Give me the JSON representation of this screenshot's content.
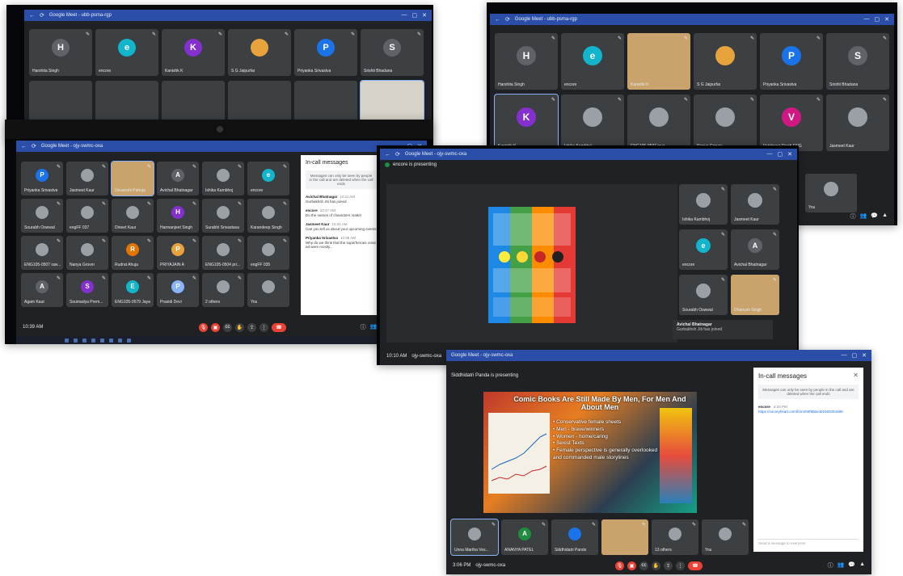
{
  "app": "Google Meet",
  "colors": {
    "meet_bg": "#202124",
    "tile_bg": "#3c4043",
    "chrome_bar": "#2b4fa8",
    "end_call": "#ea4335",
    "accent": "#8ab4f8"
  },
  "photo1": {
    "title": "Google Meet - ubb-psma-rgp",
    "tiles": [
      {
        "initial": "H",
        "name": "Harshita Singh",
        "color": "#5f6368"
      },
      {
        "initial": "e",
        "name": "encore",
        "color": "#12b5cb"
      },
      {
        "initial": "K",
        "name": "Kanishk K",
        "color": "#8430ce"
      },
      {
        "initial": "",
        "name": "S G Jaipurfar",
        "color": "#e8a33d"
      },
      {
        "initial": "P",
        "name": "Priyanka Srivastva",
        "color": "#1a73e8"
      },
      {
        "initial": "S",
        "name": "Srishti Bhadana",
        "color": "#5f6368"
      }
    ]
  },
  "photo2": {
    "title": "Google Meet - ubb-psma-rgp",
    "row1": [
      {
        "initial": "H",
        "name": "Harshita Singh",
        "color": "#5f6368"
      },
      {
        "initial": "e",
        "name": "encore",
        "color": "#12b5cb"
      },
      {
        "initial": "",
        "name": "Kanishk K",
        "color": "#c9a36b"
      },
      {
        "initial": "",
        "name": "S G Jaipurfar",
        "color": "#e8a33d"
      },
      {
        "initial": "P",
        "name": "Priyanka Srivastva",
        "color": "#1a73e8"
      },
      {
        "initial": "S",
        "name": "Srishti Bhadana",
        "color": "#5f6368"
      }
    ],
    "row2": [
      {
        "initial": "K",
        "name": "Kanishk K",
        "color": "#8430ce"
      },
      {
        "initial": "",
        "name": "Ishika Kambhoj",
        "color": "#9aa0a6"
      },
      {
        "initial": "",
        "name": "ENG105-0537 jaya",
        "color": "#9aa0a6"
      },
      {
        "initial": "",
        "name": "Nanya Grover",
        "color": "#9aa0a6"
      },
      {
        "initial": "V",
        "name": "Vaishnavi Singh ENG",
        "color": "#d01884"
      },
      {
        "initial": "",
        "name": "Jasmeet Kaur",
        "color": "#9aa0a6"
      }
    ],
    "you_label": "You"
  },
  "photo3": {
    "title": "Google Meet - ojy-swmc-oxa",
    "tiles": [
      {
        "initial": "P",
        "name": "Priyanka Srivastva",
        "color": "#1a73e8"
      },
      {
        "initial": "",
        "name": "Jasmeet Kaur",
        "color": "#9aa0a6"
      },
      {
        "initial": "",
        "name": "Devanshi Pahuja",
        "color": "#c9a36b"
      },
      {
        "initial": "A",
        "name": "Avichal Bhatnagar",
        "color": "#5f6368"
      },
      {
        "initial": "",
        "name": "Ishika Kambhoj",
        "color": "#9aa0a6"
      },
      {
        "initial": "e",
        "name": "encore",
        "color": "#12b5cb"
      },
      {
        "initial": "",
        "name": "Sourabh Oswwal",
        "color": "#9aa0a6"
      },
      {
        "initial": "",
        "name": "engFF 037",
        "color": "#9aa0a6"
      },
      {
        "initial": "",
        "name": "Dineet Kaur",
        "color": "#9aa0a6"
      },
      {
        "initial": "H",
        "name": "Harmanjeet Singh",
        "color": "#8430ce"
      },
      {
        "initial": "",
        "name": "Surabhi Srivastava",
        "color": "#9aa0a6"
      },
      {
        "initial": "",
        "name": "Karandeep Singh",
        "color": "#9aa0a6"
      },
      {
        "initial": "",
        "name": "ENG105-0507 raw...",
        "color": "#9aa0a6"
      },
      {
        "initial": "",
        "name": "Nanya Grover",
        "color": "#9aa0a6"
      },
      {
        "initial": "R",
        "name": "Rudrat Ahuja",
        "color": "#e37400"
      },
      {
        "initial": "P",
        "name": "PRIYAJAIN A",
        "color": "#e8a33d"
      },
      {
        "initial": "",
        "name": "ENG105-0504 pri...",
        "color": "#9aa0a6"
      },
      {
        "initial": "",
        "name": "engFF 035",
        "color": "#9aa0a6"
      },
      {
        "initial": "A",
        "name": "Agam Kaur",
        "color": "#5f6368"
      },
      {
        "initial": "S",
        "name": "Soumadya Prem...",
        "color": "#8430ce"
      },
      {
        "initial": "E",
        "name": "ENG105-0579 Jaya",
        "color": "#12b5cb"
      },
      {
        "initial": "P",
        "name": "Prasidi Devi",
        "color": "#8ab4f8"
      },
      {
        "initial": "",
        "name": "2 others",
        "color": "#9aa0a6"
      },
      {
        "initial": "",
        "name": "You",
        "color": "#9aa0a6"
      }
    ],
    "chat": {
      "title": "In-call messages",
      "note": "Messages can only be seen by people in the call and are deleted when the call ends",
      "messages": [
        {
          "who": "Avichal Bhatnagar",
          "ts": "10:11 AM",
          "text": "Gurbakhsh Jiti has joined"
        },
        {
          "who": "encore",
          "ts": "10:27 AM",
          "text": "Do the names of characters matter"
        },
        {
          "who": "Jasmeet Kaur",
          "ts": "10:31 AM",
          "text": "Can you tell us about your upcoming events"
        },
        {
          "who": "Priyanka Srivastva",
          "ts": "10:36 AM",
          "text": "Why do we think that the superheroes created were mostly..."
        }
      ]
    },
    "time": "10:39 AM",
    "code": "ojy-swmc-oxa"
  },
  "photo4": {
    "title": "Google Meet - ojy-swmc-oxa",
    "presenting": "encore is presenting",
    "side_tiles": [
      {
        "initial": "",
        "name": "Ishika Kambhoj",
        "color": "#9aa0a6"
      },
      {
        "initial": "",
        "name": "Jasmeet Kaur",
        "color": "#9aa0a6"
      },
      {
        "initial": "e",
        "name": "encore",
        "color": "#12b5cb"
      },
      {
        "initial": "A",
        "name": "Avichal Bhatnagar",
        "color": "#5f6368"
      },
      {
        "initial": "",
        "name": "Sourabh Oswwal",
        "color": "#9aa0a6"
      },
      {
        "initial": "",
        "name": "Dhanush Singh",
        "color": "#c9a36b"
      }
    ],
    "notice_name": "Avichal Bhatnagar",
    "notice_text": "Gurbakhsh Jiti has joined",
    "time": "10:10 AM",
    "code": "ojy-swmc-oxa"
  },
  "photo5": {
    "title": "Google Meet - ojy-swmc-oxa",
    "presenting": "Siddhidatri Panda is presenting",
    "slide_title": "Comic Books Are Still Made By Men, For Men And About Men",
    "slide_bullets": [
      "Conservative female sheets",
      "Men - brave/winners",
      "Women - home/caring",
      "Sexist Texts",
      "Female perspective is generally overlooked and commanded male storylines"
    ],
    "chat": {
      "title": "In-call messages",
      "note": "Messages can only be seen by people in the call and are deleted when the call ends",
      "who": "encore",
      "ts": "3:34 PM",
      "link": "https://surveyheart.com/form/60f9bbe4b1b60254d89",
      "input_placeholder": "Send a message to everyone"
    },
    "tiles": [
      {
        "initial": "",
        "name": "Unna Martha Ves...",
        "color": "#9aa0a6"
      },
      {
        "initial": "A",
        "name": "ANANYA PATEL",
        "color": "#1e8e3e"
      },
      {
        "initial": "",
        "name": "Siddhidatri Panda",
        "color": "#1a73e8"
      },
      {
        "initial": "",
        "name": "",
        "color": "#c9a36b"
      },
      {
        "initial": "",
        "name": "13 others",
        "color": "#9aa0a6"
      },
      {
        "initial": "",
        "name": "You",
        "color": "#9aa0a6"
      }
    ],
    "time": "3:06 PM",
    "code": "ojy-swmc-oxa"
  }
}
